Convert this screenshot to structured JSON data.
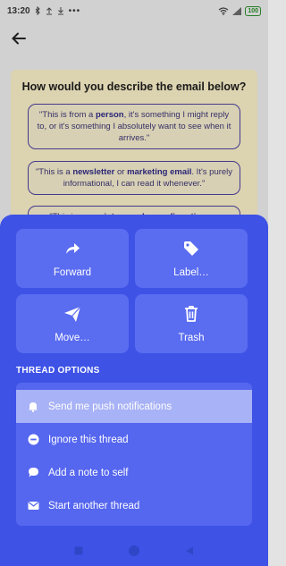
{
  "status_bar": {
    "time": "13:20",
    "battery": "100"
  },
  "background": {
    "heading": "How would you describe the email below?",
    "options": [
      {
        "pre": "\"This is from a ",
        "bold1": "person",
        "mid": ", it's something I might reply to, or it's something I absolutely want to see when it arrives.\"",
        "bold2": "",
        "post": ""
      },
      {
        "pre": "\"This is a ",
        "bold1": "newsletter",
        "mid": " or ",
        "bold2": "marketing email",
        "post": ". It's purely informational, I can read it whenever.\""
      },
      {
        "pre": "\"This is a ",
        "bold1": "receipt",
        "mid": ", an ",
        "bold2": "order confirmation",
        "post": ", or"
      }
    ]
  },
  "actions": [
    {
      "label": "Forward",
      "icon": "forward-icon"
    },
    {
      "label": "Label…",
      "icon": "tag-icon"
    },
    {
      "label": "Move…",
      "icon": "send-icon"
    },
    {
      "label": "Trash",
      "icon": "trash-icon"
    }
  ],
  "thread_options": {
    "title": "THREAD OPTIONS",
    "items": [
      {
        "label": "Send me push notifications",
        "icon": "bell-icon",
        "selected": true
      },
      {
        "label": "Ignore this thread",
        "icon": "minus-circle-icon",
        "selected": false
      },
      {
        "label": "Add a note to self",
        "icon": "speech-bubble-icon",
        "selected": false
      },
      {
        "label": "Start another thread",
        "icon": "envelope-icon",
        "selected": false
      }
    ]
  },
  "colors": {
    "sheet": "#3e52e6",
    "tile": "#5a6cf0",
    "selected_row": "#a8b2f6"
  }
}
